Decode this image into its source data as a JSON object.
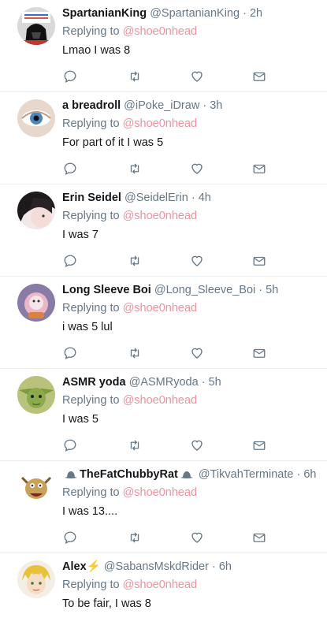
{
  "tweets": [
    {
      "name": "SpartanianKing",
      "handle": "@SpartanianKing",
      "sep": "·",
      "time": "2h",
      "replying_label": "Replying to",
      "mention": "@shoe0nhead",
      "text": "Lmao I was 8",
      "avatar": "darth-vader-avatar"
    },
    {
      "name": "a breadroll",
      "handle": "@iPoke_iDraw",
      "sep": "·",
      "time": "3h",
      "replying_label": "Replying to",
      "mention": "@shoe0nhead",
      "text": "For part of it I was 5",
      "avatar": "eye-avatar"
    },
    {
      "name": "Erin Seidel",
      "handle": "@SeidelErin",
      "sep": "·",
      "time": "4h",
      "replying_label": "Replying to",
      "mention": "@shoe0nhead",
      "text": "I was 7",
      "avatar": "portrait-avatar"
    },
    {
      "name": "Long Sleeve Boi",
      "handle": "@Long_Sleeve_Boi",
      "sep": "·",
      "time": "5h",
      "replying_label": "Replying to",
      "mention": "@shoe0nhead",
      "text": "i was 5 lul",
      "avatar": "toy-avatar"
    },
    {
      "name": "ASMR yoda",
      "handle": "@ASMRyoda",
      "sep": "·",
      "time": "5h",
      "replying_label": "Replying to",
      "mention": "@shoe0nhead",
      "text": "I was 5",
      "avatar": "yoda-avatar"
    },
    {
      "name": "TheFatChubbyRat",
      "handle": "@TikvahTerminate",
      "sep": "·",
      "time": "6h",
      "replying_label": "Replying to",
      "mention": "@shoe0nhead",
      "text": "I was 13....",
      "avatar": "cartoon-avatar"
    },
    {
      "name": "Alex",
      "name_emoji": "⚡",
      "handle": "@SabansMskdRider",
      "sep": "·",
      "time": "6h",
      "replying_label": "Replying to",
      "mention": "@shoe0nhead",
      "text": "To be fair, I was 8",
      "avatar": "anime-avatar"
    }
  ],
  "icons": {
    "reply": "reply-icon",
    "retweet": "retweet-icon",
    "like": "heart-icon",
    "message": "envelope-icon"
  },
  "colors": {
    "mention": "#f0919d",
    "meta": "#657786",
    "icon": "#657786",
    "divider": "#e6ecf0"
  }
}
